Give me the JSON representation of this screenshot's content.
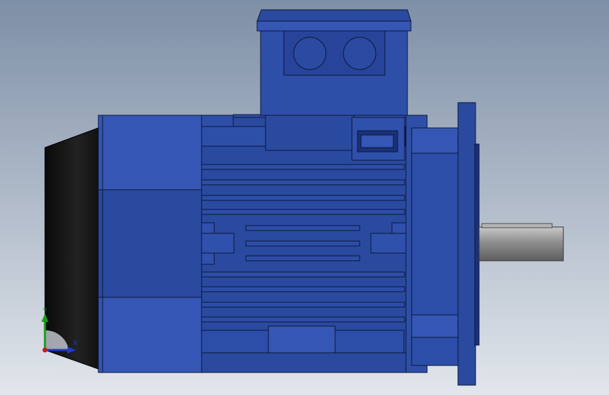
{
  "viewport": {
    "background_top": "#7d8fa6",
    "background_bottom": "#e2e6ec"
  },
  "colors": {
    "motor_blue": "#2a4aa0",
    "motor_blue_light": "#3556b4",
    "motor_blue_dark": "#1a3178",
    "motor_outline": "#0c1636",
    "fan_cover": "#141414",
    "shaft": "#9a9a9a",
    "axis_x": "#1e3cc8",
    "axis_y": "#1a9a1a",
    "axis_origin": "#c81e1e"
  },
  "triad": {
    "x_label": "X",
    "y_label": "Y"
  }
}
